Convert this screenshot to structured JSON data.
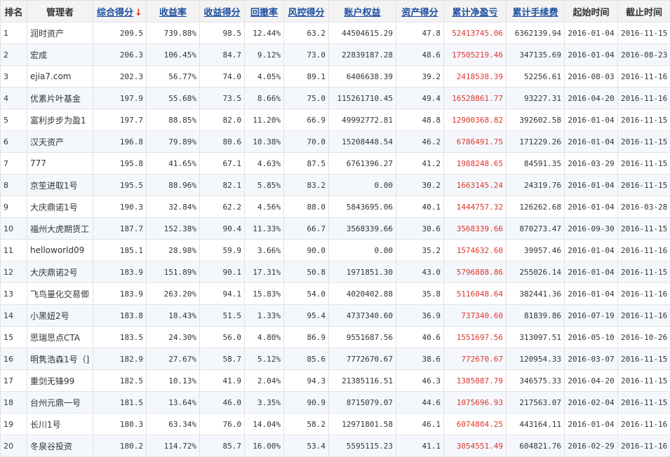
{
  "table": {
    "columns": [
      {
        "key": "rank",
        "label": "排名",
        "sortable": false
      },
      {
        "key": "manager",
        "label": "管理者",
        "sortable": false
      },
      {
        "key": "score",
        "label": "综合得分",
        "sortable": true,
        "sorted": true,
        "sort_icon": "arrow-down-icon",
        "sort_glyph": "↓"
      },
      {
        "key": "return",
        "label": "收益率",
        "sortable": true
      },
      {
        "key": "return_score",
        "label": "收益得分",
        "sortable": true
      },
      {
        "key": "drawdown",
        "label": "回撤率",
        "sortable": true
      },
      {
        "key": "risk_score",
        "label": "风控得分",
        "sortable": true
      },
      {
        "key": "equity",
        "label": "账户权益",
        "sortable": true
      },
      {
        "key": "asset_score",
        "label": "资产得分",
        "sortable": true
      },
      {
        "key": "net_pnl",
        "label": "累计净盈亏",
        "sortable": true
      },
      {
        "key": "fees",
        "label": "累计手续费",
        "sortable": true
      },
      {
        "key": "start",
        "label": "起始时间",
        "sortable": false
      },
      {
        "key": "end",
        "label": "截止时间",
        "sortable": false
      }
    ],
    "rows": [
      [
        "1",
        "润时资产",
        "209.5",
        "739.88%",
        "98.5",
        "12.44%",
        "63.2",
        "44504615.29",
        "47.8",
        "52413745.06",
        "6362139.94",
        "2016-01-04",
        "2016-11-15"
      ],
      [
        "2",
        "宏成",
        "206.3",
        "106.45%",
        "84.7",
        "9.12%",
        "73.0",
        "22839187.28",
        "48.6",
        "17505219.46",
        "347135.69",
        "2016-01-04",
        "2016-08-23"
      ],
      [
        "3",
        "ejia7.com",
        "202.3",
        "56.77%",
        "74.0",
        "4.05%",
        "89.1",
        "6406638.39",
        "39.2",
        "2418538.39",
        "52256.61",
        "2016-08-03",
        "2016-11-16"
      ],
      [
        "4",
        "优素片叶基金",
        "197.9",
        "55.68%",
        "73.5",
        "8.66%",
        "75.0",
        "115261710.45",
        "49.4",
        "16528861.77",
        "93227.31",
        "2016-04-20",
        "2016-11-16"
      ],
      [
        "5",
        "富利步步为盈1",
        "197.7",
        "88.85%",
        "82.0",
        "11.20%",
        "66.9",
        "49992772.81",
        "48.8",
        "12900368.82",
        "392602.58",
        "2016-01-04",
        "2016-11-15"
      ],
      [
        "6",
        "汉天资产",
        "196.8",
        "79.89%",
        "80.6",
        "10.38%",
        "70.0",
        "15208448.54",
        "46.2",
        "6786491.75",
        "171229.26",
        "2016-01-04",
        "2016-11-15"
      ],
      [
        "7",
        "777",
        "195.8",
        "41.65%",
        "67.1",
        "4.63%",
        "87.5",
        "6761396.27",
        "41.2",
        "1988248.65",
        "84591.35",
        "2016-03-29",
        "2016-11-15"
      ],
      [
        "8",
        "京笙进取1号",
        "195.5",
        "88.96%",
        "82.1",
        "5.85%",
        "83.2",
        "0.00",
        "30.2",
        "1663145.24",
        "24319.76",
        "2016-01-04",
        "2016-11-15"
      ],
      [
        "9",
        "大庆鼎诺1号",
        "190.3",
        "32.84%",
        "62.2",
        "4.56%",
        "88.0",
        "5843695.06",
        "40.1",
        "1444757.32",
        "126262.68",
        "2016-01-04",
        "2016-03-28"
      ],
      [
        "10",
        "福州大虎期货工",
        "187.7",
        "152.38%",
        "90.4",
        "11.33%",
        "66.7",
        "3568339.66",
        "30.6",
        "3568339.66",
        "870273.47",
        "2016-09-30",
        "2016-11-15"
      ],
      [
        "11",
        "helloworld09",
        "185.1",
        "28.98%",
        "59.9",
        "3.66%",
        "90.0",
        "0.00",
        "35.2",
        "1574632.60",
        "39957.46",
        "2016-01-04",
        "2016-11-16"
      ],
      [
        "12",
        "大庆鼎诺2号",
        "183.9",
        "151.89%",
        "90.1",
        "17.31%",
        "50.8",
        "1971851.30",
        "43.0",
        "5796888.86",
        "255026.14",
        "2016-01-04",
        "2016-11-15"
      ],
      [
        "13",
        "飞鸟量化交易㑡",
        "183.9",
        "263.20%",
        "94.1",
        "15.83%",
        "54.0",
        "4020402.88",
        "35.8",
        "5116048.64",
        "382441.36",
        "2016-01-04",
        "2016-11-16"
      ],
      [
        "14",
        "小黑妞2号",
        "183.8",
        "18.43%",
        "51.5",
        "1.33%",
        "95.4",
        "4737340.60",
        "36.9",
        "737340.60",
        "81839.86",
        "2016-07-19",
        "2016-11-16"
      ],
      [
        "15",
        "思瑞思点CTA",
        "183.5",
        "24.30%",
        "56.0",
        "4.80%",
        "86.9",
        "9551687.56",
        "40.6",
        "1551697.56",
        "313097.51",
        "2016-05-10",
        "2016-10-26"
      ],
      [
        "16",
        "明隽浩森1号（]",
        "182.9",
        "27.67%",
        "58.7",
        "5.12%",
        "85.6",
        "7772670.67",
        "38.6",
        "772670.67",
        "120954.33",
        "2016-03-07",
        "2016-11-15"
      ],
      [
        "17",
        "重剑无锋99",
        "182.5",
        "10.13%",
        "41.9",
        "2.04%",
        "94.3",
        "21385116.51",
        "46.3",
        "1385087.79",
        "346575.33",
        "2016-04-20",
        "2016-11-15"
      ],
      [
        "18",
        "台州元鼎一号",
        "181.5",
        "13.64%",
        "46.0",
        "3.35%",
        "90.9",
        "8715079.07",
        "44.6",
        "1075696.93",
        "217563.07",
        "2016-02-04",
        "2016-11-15"
      ],
      [
        "19",
        "长川1号",
        "180.3",
        "63.34%",
        "76.0",
        "14.04%",
        "58.2",
        "12971801.58",
        "46.1",
        "6074804.25",
        "443164.11",
        "2016-01-04",
        "2016-11-16"
      ],
      [
        "20",
        "冬泉谷投资",
        "180.2",
        "114.72%",
        "85.7",
        "16.00%",
        "53.4",
        "5595115.23",
        "41.1",
        "3054551.49",
        "604821.76",
        "2016-02-29",
        "2016-11-16"
      ]
    ]
  },
  "colors": {
    "link": "#1e50a2",
    "profit": "#e0342c",
    "header_bg": "#f3f3f3",
    "alt_row_bg": "#f4f8fc",
    "border": "#e2e2e2"
  }
}
